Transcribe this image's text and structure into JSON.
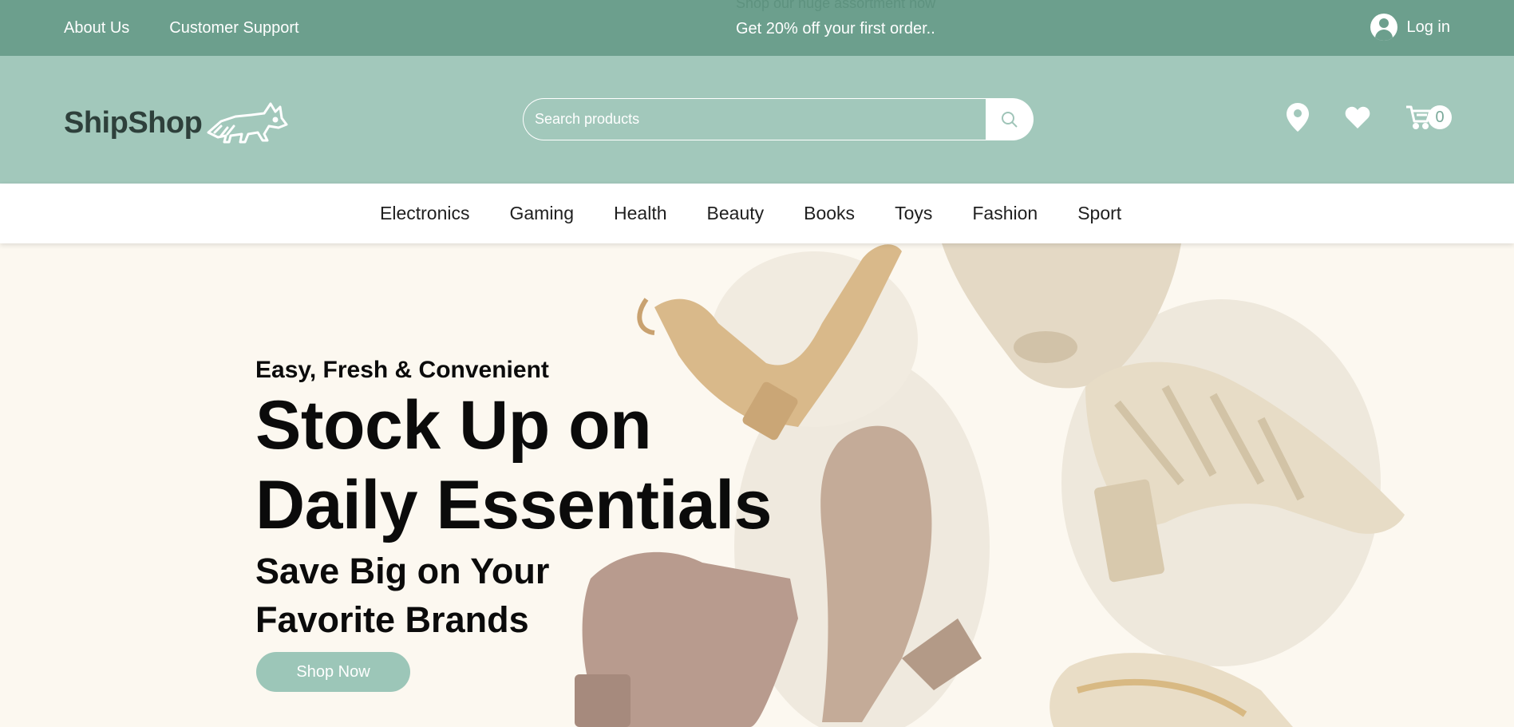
{
  "topbar": {
    "links": [
      "About Us",
      "Customer Support"
    ],
    "promo": "Get 20% off your first order..",
    "ghost_promo": "Shop our huge assortment now",
    "login_label": "Log in"
  },
  "header": {
    "logo_text": "ShipShop",
    "search_placeholder": "Search products",
    "cart_count": "0"
  },
  "nav": {
    "items": [
      "Electronics",
      "Gaming",
      "Health",
      "Beauty",
      "Books",
      "Toys",
      "Fashion",
      "Sport"
    ]
  },
  "hero": {
    "tagline": "Easy, Fresh & Convenient",
    "title_line1": "Stock Up on",
    "title_line2": "Daily Essentials",
    "sub_line1": "Save Big on Your",
    "sub_line2": "Favorite Brands",
    "cta_label": "Shop Now"
  },
  "colors": {
    "topbar": "#6c9f8d",
    "header": "#a2c8bb",
    "accent_button": "#9cc6b8",
    "hero_bg": "#fcf8f0"
  },
  "icons": [
    "user-icon",
    "raccoon-logo-icon",
    "search-icon",
    "location-pin-icon",
    "heart-icon",
    "cart-icon"
  ]
}
